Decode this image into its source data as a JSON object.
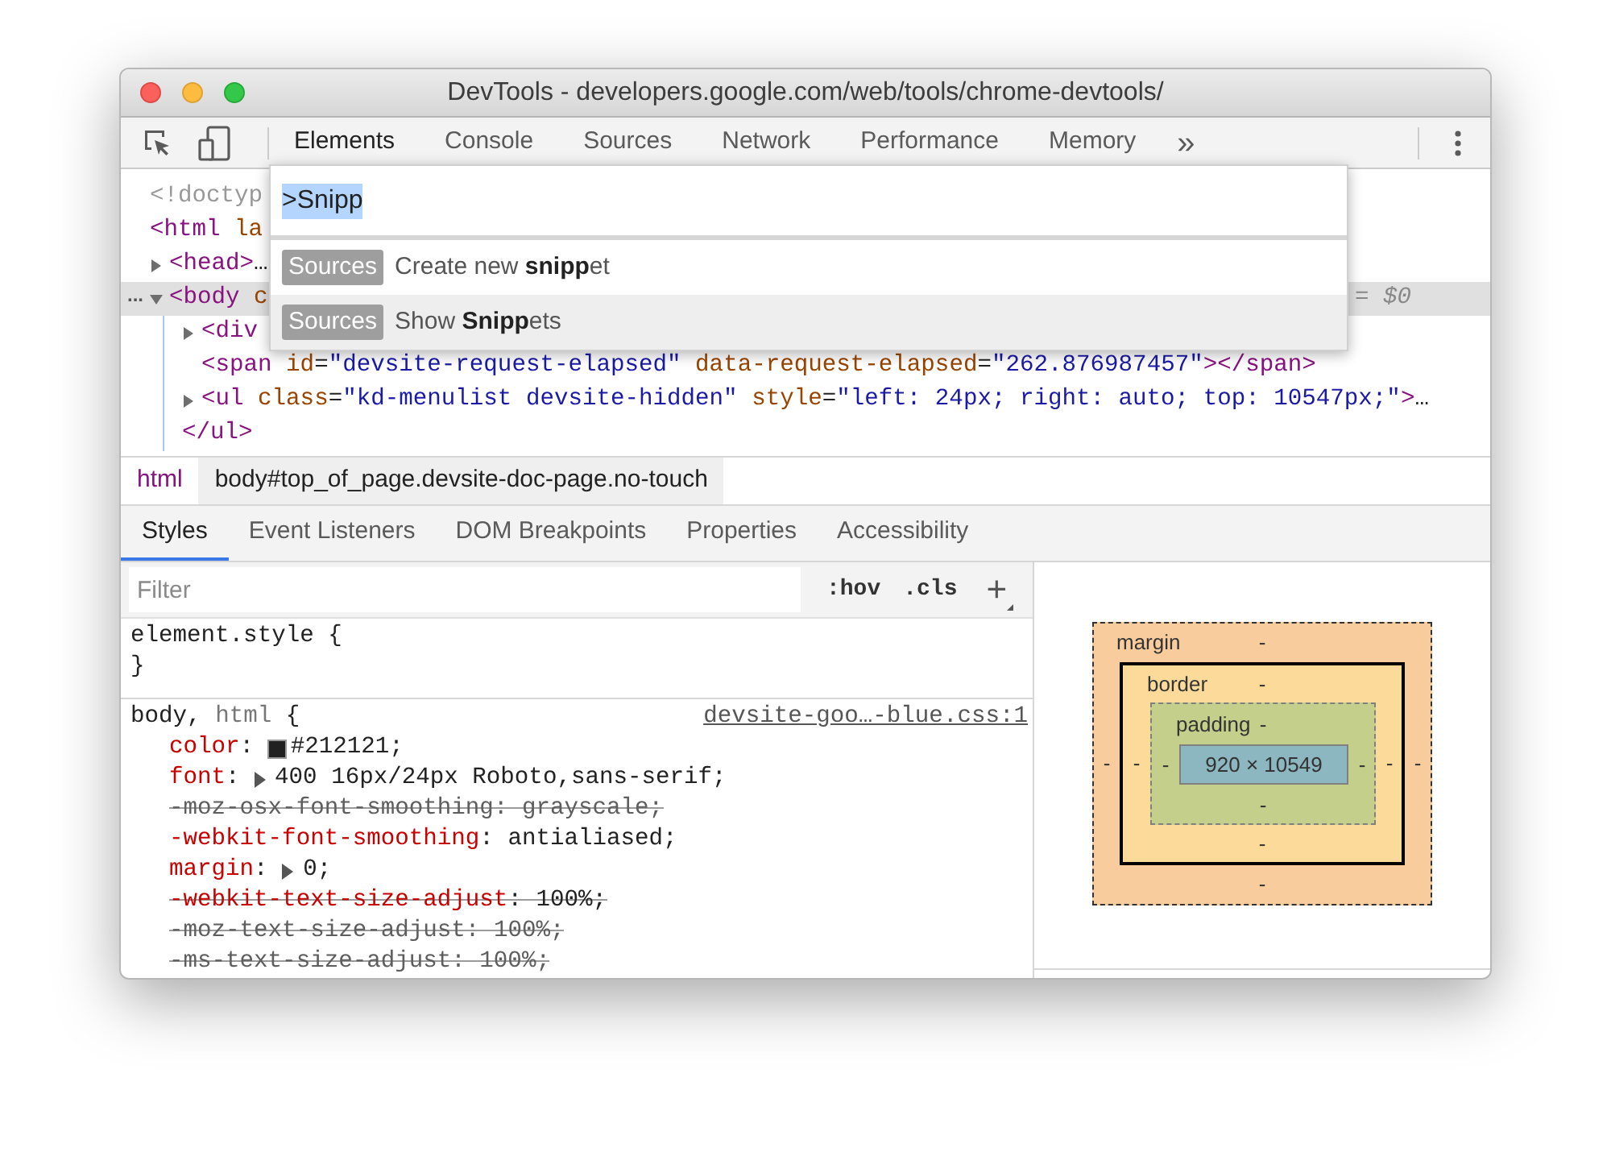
{
  "window": {
    "title": "DevTools - developers.google.com/web/tools/chrome-devtools/"
  },
  "toolbar": {
    "tabs": [
      {
        "label": "Elements",
        "selected": true
      },
      {
        "label": "Console",
        "selected": false
      },
      {
        "label": "Sources",
        "selected": false
      },
      {
        "label": "Network",
        "selected": false
      },
      {
        "label": "Performance",
        "selected": false
      },
      {
        "label": "Memory",
        "selected": false
      }
    ],
    "more": "»"
  },
  "dom_tree": [
    {
      "tokens": [
        {
          "kind": "doc",
          "text": "<!doctyp"
        }
      ],
      "selected": false
    },
    {
      "tokens": [
        {
          "kind": "tag",
          "text": "<html"
        },
        {
          "kind": "attr",
          "text": " la"
        }
      ],
      "selected": false,
      "children": [
        {
          "expanded": false,
          "tokens": [
            {
              "kind": "tag",
              "text": "<head>"
            },
            {
              "kind": "plain",
              "text": "…"
            }
          ],
          "selected": false
        },
        {
          "expanded": true,
          "marker": "...",
          "hint": "= $0",
          "tokens": [
            {
              "kind": "tag",
              "text": "<body"
            },
            {
              "kind": "attr",
              "text": " c"
            }
          ],
          "selected": true,
          "children": [
            {
              "expanded": false,
              "tokens": [
                {
                  "kind": "tag",
                  "text": "<div"
                }
              ],
              "selected": false
            },
            {
              "tokens": [
                {
                  "kind": "tag",
                  "text": "<span"
                },
                {
                  "kind": "attr",
                  "text": " id"
                },
                {
                  "kind": "plain",
                  "text": "="
                },
                {
                  "kind": "value",
                  "text": "\"devsite-request-elapsed\""
                },
                {
                  "kind": "attr",
                  "text": " data-request-elapsed"
                },
                {
                  "kind": "plain",
                  "text": "="
                },
                {
                  "kind": "value",
                  "text": "\"262.876987457\""
                },
                {
                  "kind": "tag",
                  "text": "></span>"
                }
              ],
              "selected": false
            },
            {
              "expanded": false,
              "tokens": [
                {
                  "kind": "tag",
                  "text": "<ul"
                },
                {
                  "kind": "attr",
                  "text": " class"
                },
                {
                  "kind": "plain",
                  "text": "="
                },
                {
                  "kind": "value",
                  "text": "\"kd-menulist devsite-hidden\""
                },
                {
                  "kind": "attr",
                  "text": " style"
                },
                {
                  "kind": "plain",
                  "text": "="
                },
                {
                  "kind": "value",
                  "text": "\"left: 24px; right: auto; top: 10547px;\""
                },
                {
                  "kind": "tag",
                  "text": ">"
                },
                {
                  "kind": "plain",
                  "text": "…"
                }
              ],
              "selected": false
            },
            {
              "kind": "close",
              "tokens": [
                {
                  "kind": "tag",
                  "text": "</ul>"
                }
              ],
              "selected": false
            }
          ]
        }
      ]
    }
  ],
  "command_menu": {
    "query": ">Snipp",
    "results": [
      {
        "badge": "Sources",
        "text": "Create new **snipp**et",
        "selected": false
      },
      {
        "badge": "Sources",
        "text": "Show **Snipp**ets",
        "selected": true
      }
    ]
  },
  "breadcrumbs": [
    {
      "label": "html",
      "selected": false
    },
    {
      "label": "body#top_of_page.devsite-doc-page.no-touch",
      "selected": true
    }
  ],
  "subtabs": [
    {
      "label": "Styles",
      "selected": true
    },
    {
      "label": "Event Listeners",
      "selected": false
    },
    {
      "label": "DOM Breakpoints",
      "selected": false
    },
    {
      "label": "Properties",
      "selected": false
    },
    {
      "label": "Accessibility",
      "selected": false
    }
  ],
  "styles": {
    "filter_placeholder": "Filter",
    "hov": ":hov",
    "cls": ".cls",
    "add": "+",
    "rules": [
      {
        "selector": [
          {
            "text": "element.style",
            "matched": true
          }
        ],
        "open": "{",
        "close": "}"
      },
      {
        "selector": [
          {
            "text": "body,",
            "matched": true
          },
          {
            "text": "html",
            "matched": false
          }
        ],
        "open": "{",
        "source": "devsite-goo…-blue.css:1",
        "declarations": [
          {
            "name": "color",
            "colon": ":",
            "value": "#212121;",
            "color": "#212121",
            "expandable": false,
            "struck": false,
            "valid": true
          },
          {
            "name": "font",
            "colon": ":",
            "value": "400 16px/24px Roboto,sans-serif;",
            "expandable": true,
            "struck": false,
            "valid": true
          },
          {
            "name": "-moz-osx-font-smoothing",
            "colon": ":",
            "value": "grayscale;",
            "expandable": false,
            "struck": true,
            "valid": false
          },
          {
            "name": "-webkit-font-smoothing",
            "colon": ":",
            "value": "antialiased;",
            "expandable": false,
            "struck": false,
            "valid": true
          },
          {
            "name": "margin",
            "colon": ":",
            "value": "0;",
            "expandable": true,
            "struck": false,
            "valid": true
          },
          {
            "name": "-webkit-text-size-adjust",
            "colon": ":",
            "value": "100%;",
            "expandable": false,
            "struck": true,
            "valid": true
          },
          {
            "name": "-moz-text-size-adjust",
            "colon": ":",
            "value": "100%;",
            "expandable": false,
            "struck": true,
            "valid": false
          },
          {
            "name": "-ms-text-size-adjust",
            "colon": ":",
            "value": "100%;",
            "expandable": false,
            "struck": true,
            "valid": false
          }
        ]
      }
    ]
  },
  "box_model": {
    "margin": {
      "label": "margin",
      "top": "-",
      "right": "-",
      "bottom": "-",
      "left": "-"
    },
    "border": {
      "label": "border",
      "top": "-",
      "right": "-",
      "bottom": "-",
      "left": "-"
    },
    "padding": {
      "label": "padding",
      "top": "-",
      "right": "-",
      "bottom": "-",
      "left": "-"
    },
    "content": "920 × 10549"
  }
}
